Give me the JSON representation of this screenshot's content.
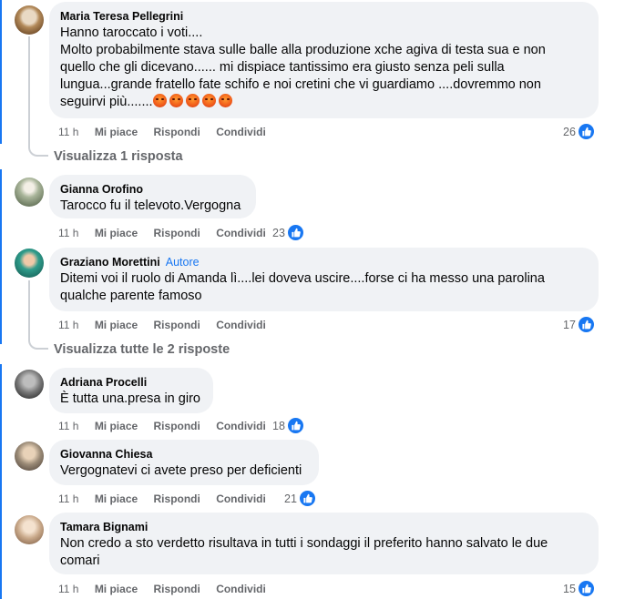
{
  "comments": [
    {
      "author": "Maria Teresa Pellegrini",
      "badge": "",
      "text_lines": [
        "Hanno taroccato i voti....",
        "Molto probabilmente stava sulle balle alla produzione xche agiva di testa sua e non",
        "quello che gli dicevano...... mi dispiace tantissimo era giusto senza peli sulla",
        "lungua...grande fratello fate schifo e noi cretini che vi guardiamo ....dovremmo non",
        "seguirvi più......."
      ],
      "emoji": "angry-face-icon x5",
      "time": "11 h",
      "like": "Mi piace",
      "reply": "Rispondi",
      "share": "Condividi",
      "reactions": "26",
      "replies_link": "Visualizza 1 risposta"
    },
    {
      "author": "Gianna Orofino",
      "badge": "",
      "text_lines": [
        "Tarocco fu il televoto.Vergogna"
      ],
      "time": "11 h",
      "like": "Mi piace",
      "reply": "Rispondi",
      "share": "Condividi",
      "reactions": "23"
    },
    {
      "author": "Graziano Morettini",
      "badge": "Autore",
      "text_lines": [
        "Ditemi voi il ruolo di Amanda lì....lei doveva uscire....forse ci ha messo una parolina",
        "qualche parente famoso"
      ],
      "time": "11 h",
      "like": "Mi piace",
      "reply": "Rispondi",
      "share": "Condividi",
      "reactions": "17",
      "replies_link": "Visualizza tutte le 2 risposte"
    },
    {
      "author": "Adriana Procelli",
      "badge": "",
      "text_lines": [
        "È tutta una.presa in giro"
      ],
      "time": "11 h",
      "like": "Mi piace",
      "reply": "Rispondi",
      "share": "Condividi",
      "reactions": "18"
    },
    {
      "author": "Giovanna Chiesa",
      "badge": "",
      "text_lines": [
        "Vergognatevi ci avete preso per deficienti"
      ],
      "time": "11 h",
      "like": "Mi piace",
      "reply": "Rispondi",
      "share": "Condividi",
      "reactions": "21"
    },
    {
      "author": "Tamara Bignami",
      "badge": "",
      "text_lines": [
        "Non credo a sto verdetto risultava in tutti i sondaggi il preferito hanno salvato le due",
        "comari"
      ],
      "time": "11 h",
      "like": "Mi piace",
      "reply": "Rispondi",
      "share": "Condividi",
      "reactions": "15"
    }
  ],
  "colors": {
    "bubble": "#f0f2f5",
    "accent": "#1877f2",
    "muted": "#65676b"
  }
}
